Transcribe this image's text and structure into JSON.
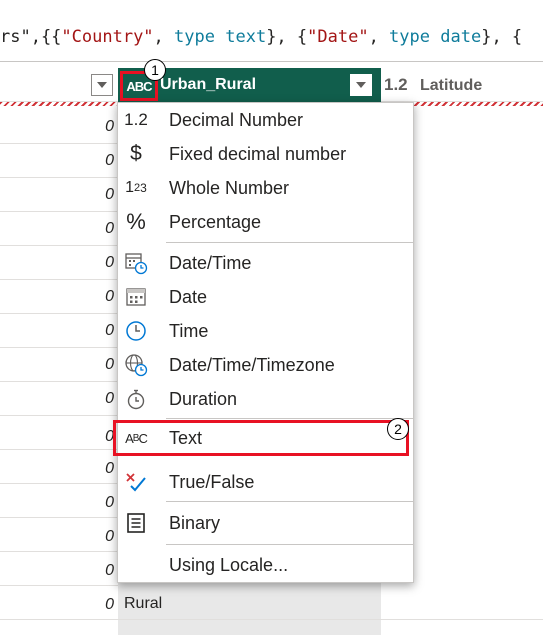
{
  "formula_bar": {
    "segments": [
      {
        "text": "rs\",{{",
        "kind": "txt"
      },
      {
        "text": "\"Country\"",
        "kind": "str"
      },
      {
        "text": ", ",
        "kind": "txt"
      },
      {
        "text": "type",
        "kind": "kw"
      },
      {
        "text": " ",
        "kind": "txt"
      },
      {
        "text": "text",
        "kind": "kw"
      },
      {
        "text": "}, {",
        "kind": "txt"
      },
      {
        "text": "\"Date\"",
        "kind": "str"
      },
      {
        "text": ", ",
        "kind": "txt"
      },
      {
        "text": "type",
        "kind": "kw"
      },
      {
        "text": " ",
        "kind": "txt"
      },
      {
        "text": "date",
        "kind": "kw"
      },
      {
        "text": "}, {",
        "kind": "txt"
      }
    ]
  },
  "columns": {
    "urban_rural": {
      "type_label": "ABC",
      "name": "Urban_Rural"
    },
    "latitude": {
      "type_label": "1.2",
      "name": "Latitude"
    }
  },
  "badges": {
    "one": "1",
    "two": "2"
  },
  "cells": {
    "zero_values": [
      "0",
      "0",
      "0",
      "0",
      "0",
      "0",
      "0",
      "0",
      "0",
      "0",
      "0",
      "0",
      "0",
      "0",
      "0"
    ],
    "rural": "Rural"
  },
  "menu": {
    "items": [
      {
        "id": "decimal-number",
        "label": "Decimal Number",
        "icon": "1.2"
      },
      {
        "id": "fixed-decimal-number",
        "label": "Fixed decimal number",
        "icon": "$"
      },
      {
        "id": "whole-number",
        "label": "Whole Number",
        "icon": "123"
      },
      {
        "id": "percentage",
        "label": "Percentage",
        "icon": "%"
      },
      {
        "id": "date-time",
        "label": "Date/Time",
        "icon": "datetime"
      },
      {
        "id": "date",
        "label": "Date",
        "icon": "calendar"
      },
      {
        "id": "time",
        "label": "Time",
        "icon": "clock"
      },
      {
        "id": "date-time-timezone",
        "label": "Date/Time/Timezone",
        "icon": "globe-clock"
      },
      {
        "id": "duration",
        "label": "Duration",
        "icon": "stopwatch"
      },
      {
        "id": "text",
        "label": "Text",
        "icon": "ABC"
      },
      {
        "id": "true-false",
        "label": "True/False",
        "icon": "cross-check"
      },
      {
        "id": "binary",
        "label": "Binary",
        "icon": "document"
      },
      {
        "id": "using-locale",
        "label": "Using Locale...",
        "icon": ""
      }
    ]
  },
  "colors": {
    "active_header": "#115e4c",
    "highlight_red": "#e81123",
    "keyword": "#0f7c9b",
    "string": "#a31515",
    "check_blue": "#0078d4",
    "cross_red": "#d13438"
  }
}
